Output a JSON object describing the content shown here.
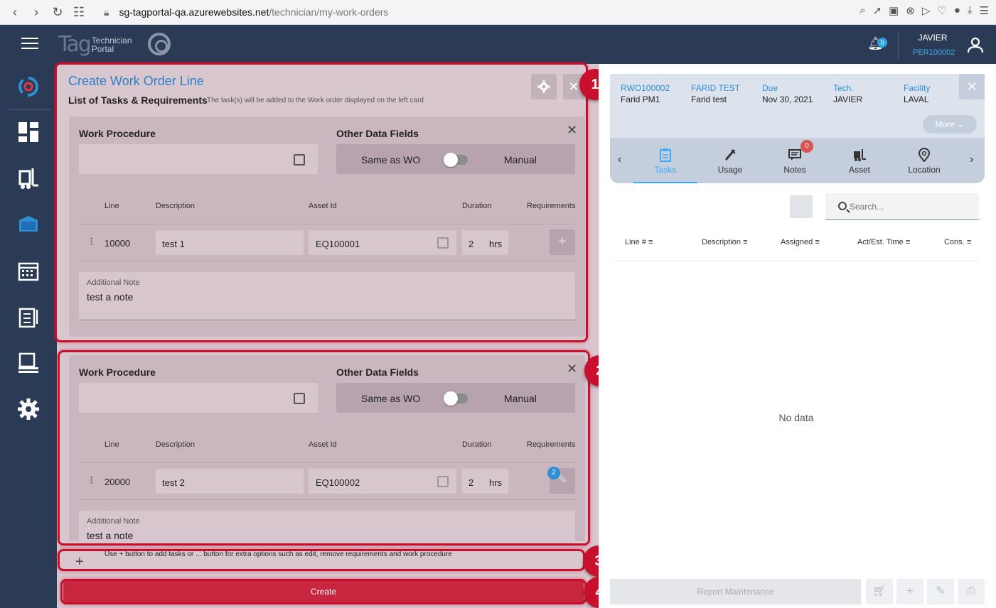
{
  "browser": {
    "url_host": "sg-tagportal-qa.azurewebsites.net",
    "url_path": "/technician/my-work-orders"
  },
  "header": {
    "logo_text": "Tag",
    "logo_sub1": "Technician",
    "logo_sub2": "Portal",
    "notif_count": "0",
    "user_name": "JAVIER",
    "user_id": "PER100002"
  },
  "card": {
    "title": "Create Work Order Line",
    "subtitle": "List of Tasks & Requirements",
    "subtitle_note": "The task(s) will be added to the Work order displayed on the left card"
  },
  "labels": {
    "work_procedure": "Work Procedure",
    "other_data_fields": "Other Data Fields",
    "same_as_wo": "Same as WO",
    "manual": "Manual",
    "col_line": "Line",
    "col_description": "Description",
    "col_asset": "Asset Id",
    "col_duration": "Duration",
    "col_requirements": "Requirements",
    "additional_note": "Additional Note",
    "hrs": "hrs"
  },
  "lines": [
    {
      "line": "10000",
      "description": "test 1",
      "asset": "EQ100001",
      "duration": "2",
      "note": "test a note",
      "req_badge": ""
    },
    {
      "line": "20000",
      "description": "test 2",
      "asset": "EQ100002",
      "duration": "2",
      "note": "test a note",
      "req_badge": "2"
    }
  ],
  "help_text": "Use + button to add tasks or ... button for extra options such as edit, remove requirements and work procedure",
  "create_label": "Create",
  "callouts": [
    "1",
    "2",
    "3",
    "4"
  ],
  "work_order": {
    "fields": [
      {
        "key": "RWO100002",
        "value": "Farid PM1"
      },
      {
        "key": "FARID TEST",
        "value": "Farid test"
      },
      {
        "key": "Due",
        "value": "Nov 30, 2021"
      },
      {
        "key": "Tech.",
        "value": "JAVIER"
      },
      {
        "key": "Facility",
        "value": "LAVAL"
      }
    ],
    "more_label": "More"
  },
  "tabs": [
    {
      "label": "Tasks",
      "icon": "clipboard-icon"
    },
    {
      "label": "Usage",
      "icon": "spark-plug-icon"
    },
    {
      "label": "Notes",
      "icon": "chat-icon",
      "badge": "0"
    },
    {
      "label": "Asset",
      "icon": "forklift-icon"
    },
    {
      "label": "Location",
      "icon": "location-pin-icon"
    }
  ],
  "tasks_table": {
    "search_placeholder": "Search...",
    "headers": [
      "Line #",
      "Description",
      "Assigned",
      "Act/Est. Time",
      "Cons."
    ],
    "empty": "No data"
  },
  "report_label": "Report Maintenance",
  "colors": {
    "accent": "#3fa9f5",
    "header_bg": "#2b3a55",
    "highlight": "#c8102e",
    "create_btn": "#c8253e"
  }
}
